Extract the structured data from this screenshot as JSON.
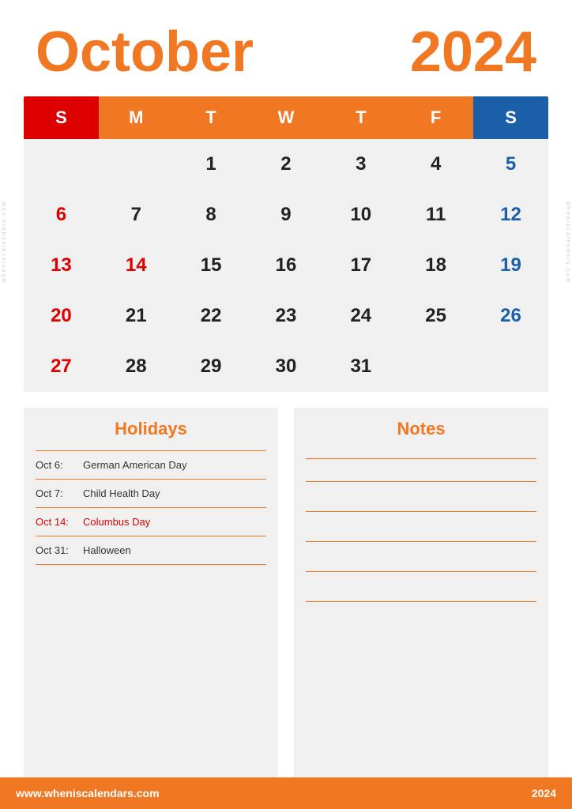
{
  "header": {
    "month": "October",
    "year": "2024"
  },
  "calendar": {
    "days_of_week": [
      "S",
      "M",
      "T",
      "W",
      "T",
      "F",
      "S"
    ],
    "weeks": [
      [
        {
          "day": "",
          "type": "empty"
        },
        {
          "day": "",
          "type": "empty"
        },
        {
          "day": "1",
          "type": "normal"
        },
        {
          "day": "2",
          "type": "normal"
        },
        {
          "day": "3",
          "type": "normal"
        },
        {
          "day": "4",
          "type": "normal"
        },
        {
          "day": "5",
          "type": "saturday"
        }
      ],
      [
        {
          "day": "6",
          "type": "sunday"
        },
        {
          "day": "7",
          "type": "normal"
        },
        {
          "day": "8",
          "type": "normal"
        },
        {
          "day": "9",
          "type": "normal"
        },
        {
          "day": "10",
          "type": "normal"
        },
        {
          "day": "11",
          "type": "normal"
        },
        {
          "day": "12",
          "type": "saturday"
        }
      ],
      [
        {
          "day": "13",
          "type": "sunday"
        },
        {
          "day": "14",
          "type": "holiday-red"
        },
        {
          "day": "15",
          "type": "normal"
        },
        {
          "day": "16",
          "type": "normal"
        },
        {
          "day": "17",
          "type": "normal"
        },
        {
          "day": "18",
          "type": "normal"
        },
        {
          "day": "19",
          "type": "saturday"
        }
      ],
      [
        {
          "day": "20",
          "type": "sunday"
        },
        {
          "day": "21",
          "type": "normal"
        },
        {
          "day": "22",
          "type": "normal"
        },
        {
          "day": "23",
          "type": "normal"
        },
        {
          "day": "24",
          "type": "normal"
        },
        {
          "day": "25",
          "type": "normal"
        },
        {
          "day": "26",
          "type": "saturday"
        }
      ],
      [
        {
          "day": "27",
          "type": "sunday"
        },
        {
          "day": "28",
          "type": "normal"
        },
        {
          "day": "29",
          "type": "normal"
        },
        {
          "day": "30",
          "type": "normal"
        },
        {
          "day": "31",
          "type": "normal"
        },
        {
          "day": "",
          "type": "empty"
        },
        {
          "day": "",
          "type": "empty"
        }
      ]
    ]
  },
  "holidays": {
    "section_title": "Holidays",
    "items": [
      {
        "date": "Oct 6:",
        "name": "German American Day",
        "is_red": false
      },
      {
        "date": "Oct 7:",
        "name": "Child Health Day",
        "is_red": false
      },
      {
        "date": "Oct 14:",
        "name": "Columbus Day",
        "is_red": true
      },
      {
        "date": "Oct 31:",
        "name": "Halloween",
        "is_red": false
      }
    ]
  },
  "notes": {
    "section_title": "Notes",
    "line_count": 5
  },
  "footer": {
    "url": "www.wheniscalendars.com",
    "year": "2024"
  },
  "watermark": {
    "text": "w h e n i s c a l e n d a r s . c o m"
  }
}
